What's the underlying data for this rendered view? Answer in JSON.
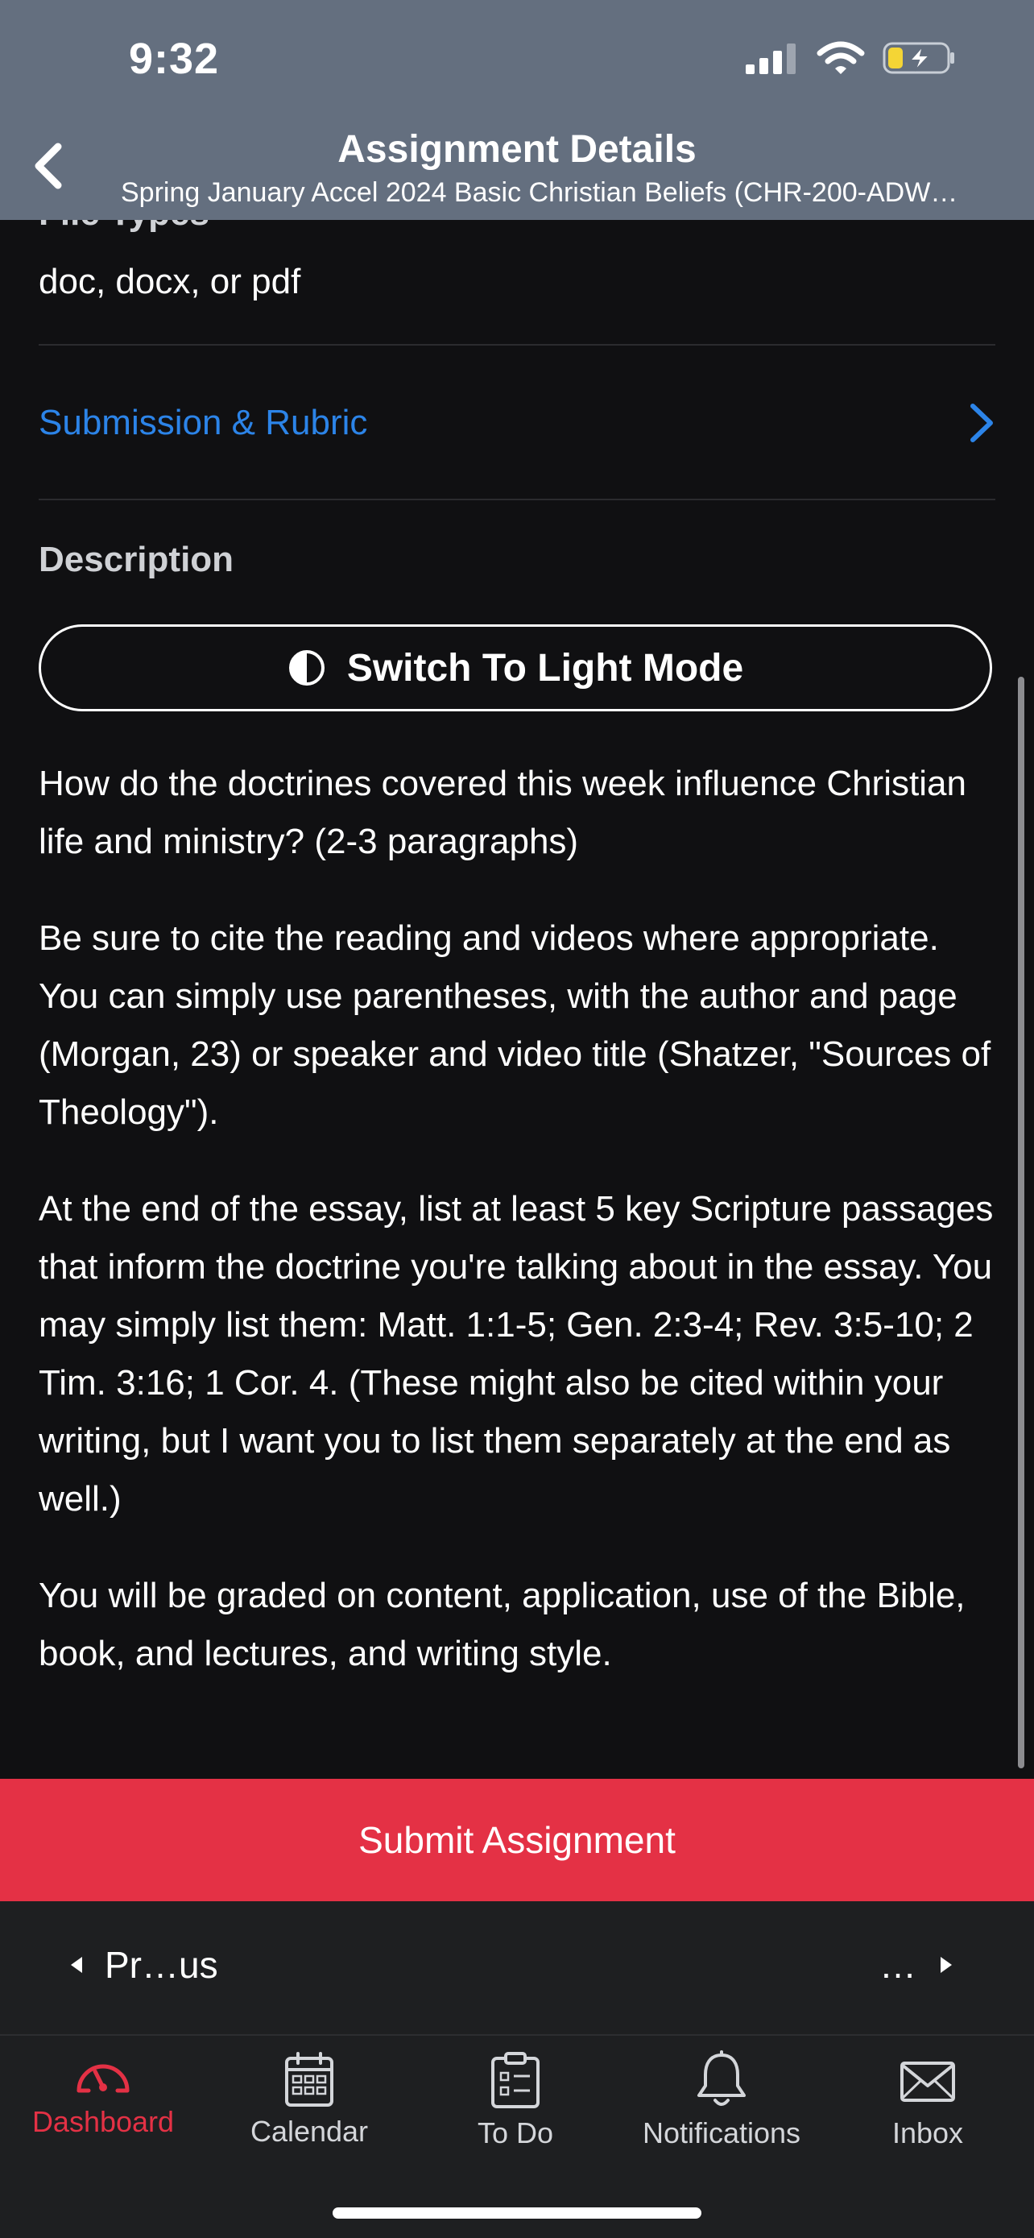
{
  "status_bar": {
    "time": "9:32"
  },
  "nav": {
    "title": "Assignment Details",
    "subtitle": "Spring January Accel 2024 Basic Christian Beliefs (CHR-200-ADW…"
  },
  "file_types": {
    "label": "File Types",
    "value": "doc, docx, or pdf"
  },
  "submission_link": {
    "label": "Submission & Rubric"
  },
  "description": {
    "label": "Description",
    "mode_button_label": "Switch To Light Mode",
    "paragraphs": [
      "How do the doctrines covered this week influence Christian life and ministry? (2-3 paragraphs)",
      "Be sure to cite the reading and videos where appropriate. You can simply use parentheses, with the author and page (Morgan, 23) or speaker and video title (Shatzer, \"Sources of Theology\").",
      "At the end of the essay, list at least 5 key Scripture passages that inform the doctrine you're talking about in the essay. You may simply list them: Matt. 1:1-5; Gen. 2:3-4; Rev. 3:5-10; 2 Tim. 3:16; 1 Cor. 4. (These might also be cited within your writing, but I want you to list them separately at the end as well.)",
      "You will be graded on content, application, use of the Bible, book, and lectures, and writing style."
    ]
  },
  "submit_button": {
    "label": "Submit Assignment"
  },
  "pager": {
    "prev_label": "Pr…us",
    "next_label": "…"
  },
  "tab_bar": {
    "items": [
      {
        "label": "Dashboard",
        "icon": "dashboard-icon",
        "active": true
      },
      {
        "label": "Calendar",
        "icon": "calendar-icon",
        "active": false
      },
      {
        "label": "To Do",
        "icon": "todo-icon",
        "active": false
      },
      {
        "label": "Notifications",
        "icon": "bell-icon",
        "active": false
      },
      {
        "label": "Inbox",
        "icon": "envelope-icon",
        "active": false
      }
    ]
  },
  "colors": {
    "header_bg": "#646f7f",
    "content_bg": "#101012",
    "link": "#2c84e8",
    "accent": "#e43145",
    "battery_charging": "#f4d535"
  }
}
